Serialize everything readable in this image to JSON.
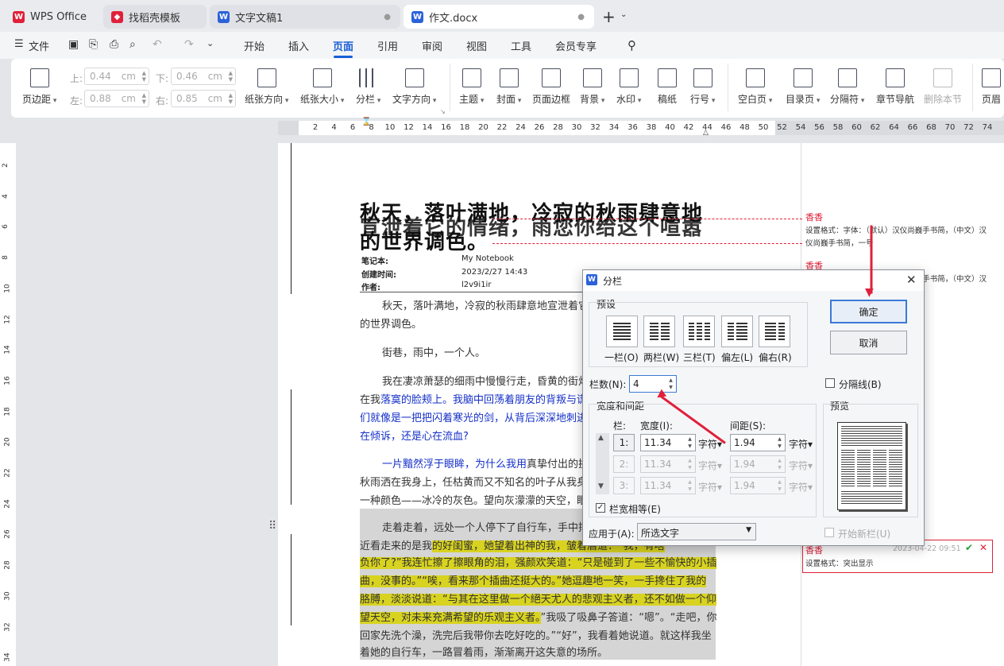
{
  "tabs": [
    {
      "label": "WPS Office",
      "icon": "wps-logo-icon",
      "color": "#e0203a"
    },
    {
      "label": "找稻壳模板",
      "icon": "docer-icon",
      "color": "#e0203a"
    },
    {
      "label": "文字文稿1",
      "icon": "writer-icon",
      "color": "#2b62d9"
    },
    {
      "label": "作文.docx",
      "icon": "writer-icon",
      "color": "#2b62d9"
    }
  ],
  "menu": {
    "file": "文件",
    "items": [
      "开始",
      "插入",
      "页面",
      "引用",
      "审阅",
      "视图",
      "工具",
      "会员专享"
    ],
    "active": "页面"
  },
  "ribbon": {
    "margins": "页边距",
    "top_lbl": "上:",
    "top_val": "0.44",
    "bottom_lbl": "下:",
    "bottom_val": "0.46",
    "left_lbl": "左:",
    "left_val": "0.88",
    "right_lbl": "右:",
    "right_val": "0.85",
    "unit": "cm",
    "items": [
      "纸张方向",
      "纸张大小",
      "分栏",
      "文字方向",
      "主题",
      "封面",
      "页面边框",
      "背景",
      "水印",
      "稿纸",
      "行号",
      "空白页",
      "目录页",
      "分隔符",
      "章节导航",
      "删除本节",
      "页眉"
    ]
  },
  "ruler_ticks": [
    "2",
    "4",
    "6",
    "8",
    "10",
    "12",
    "14",
    "16",
    "18",
    "20",
    "22",
    "24",
    "26",
    "28",
    "30",
    "32",
    "34",
    "36",
    "38",
    "40",
    "42",
    "44",
    "46",
    "48",
    "50",
    "52",
    "54",
    "56",
    "58",
    "60",
    "62",
    "64",
    "66",
    "68",
    "70",
    "72",
    "74"
  ],
  "vruler_ticks": [
    "2",
    "4",
    "6",
    "8",
    "10",
    "12",
    "14",
    "16",
    "18",
    "20",
    "22",
    "24",
    "26",
    "28",
    "30",
    "32",
    "34"
  ],
  "doc": {
    "title1": "秋天，落叶满地，冷寂的秋雨肆意地",
    "title2": "宣泄着它的情绪，雨您你给这个喧嚣",
    "title3": "的世界调色。",
    "meta": [
      {
        "k": "笔记本:",
        "v": "My Notebook"
      },
      {
        "k": "创建时间:",
        "v": "2023/2/27 14:43"
      },
      {
        "k": "作者:",
        "v": "l2v9i1ir"
      }
    ],
    "p1a": "秋天，落叶满地，冷寂的秋雨肆意地宣泄着它",
    "p1b": "的世界调色。",
    "p2": "街巷，雨中，一个人。",
    "p3a": "我在凄凉萧瑟的细雨中慢慢行走，昏黄的街灯",
    "p3b_pre": "在我",
    "p3b": "落寞的脸颊上。我脑中回荡着朋友的背叛与谎",
    "p3c": "们就像是一把把闪着寒光的剑，从背后深深地刺进",
    "p3d": "在倾诉，还是心在流血?",
    "p4a_blue": "一片黯然浮于眼眸，为什么我用",
    "p4a": "真挚付出的换",
    "p4b": "秋雨洒在我身上，任枯黄而又不知名的叶子从我身",
    "p4c": "一种颜色——冰冷的灰色。望向灰濛濛的天空，眼",
    "p5a": "走着走着，远处一个人停下了自行车，手中撑",
    "p5b1": "近看走来的是我",
    "p5b2": "的好闺蜜，她望着出神的我，皱着眉道：“我，有啥",
    "p5c": "负你了?”我连忙擦了擦眼角的泪，强颜欢笑道：“只是碰到了一些不愉快的小插",
    "p5d": "曲，没事的。”“唉，看来那个插曲还挺大的。”她逗趣地一笑，一手搀住了我的",
    "p5e": "胳膊，淡淡说道：“与其在这里做一个絕天尤人的悲观主义者，还不如做一个仰",
    "p5f1": "望天空，对未来充满希望的乐观主义者。",
    "p5f2": "”我吸了吸鼻子答道：“嗯”。“走吧，你",
    "p5g": "回家先洗个澡，洗完后我带你去吃好吃的。”“好”，我看着她说道。就这样我坐",
    "p5h": "着她的自行车，一路冒着雨，渐渐离开这失意的场所。"
  },
  "comments": [
    {
      "author": "香香",
      "text1": "设置格式：字体：（默认）汉仪尚巍手书简，（中文）汉",
      "text2": "仪尚巍手书简，一号"
    },
    {
      "author": "香香",
      "text1": "设置格式：字体：（默认）汉仪尚巍手书简，（中文）汉"
    },
    {
      "author": "香香",
      "date": "2023-04-22 09:51",
      "text1": "设置格式：突出显示"
    }
  ],
  "dialog": {
    "title": "分栏",
    "presets_label": "预设",
    "presets": [
      "一栏(O)",
      "两栏(W)",
      "三栏(T)",
      "偏左(L)",
      "偏右(R)"
    ],
    "ok": "确定",
    "cancel": "取消",
    "num_label": "栏数(N):",
    "num_value": "4",
    "separator": "分隔线(B)",
    "width_spacing": "宽度和间距",
    "col_hdr": "栏:",
    "width_hdr": "宽度(I):",
    "spacing_hdr": "间距(S):",
    "unit": "字符",
    "rows": [
      {
        "n": "1:",
        "w": "11.34",
        "s": "1.94"
      },
      {
        "n": "2:",
        "w": "11.34",
        "s": "1.94"
      },
      {
        "n": "3:",
        "w": "11.34",
        "s": "1.94"
      }
    ],
    "equal": "栏宽相等(E)",
    "apply_label": "应用于(A):",
    "apply_value": "所选文字",
    "preview": "预览",
    "new_col": "开始新栏(U)"
  }
}
